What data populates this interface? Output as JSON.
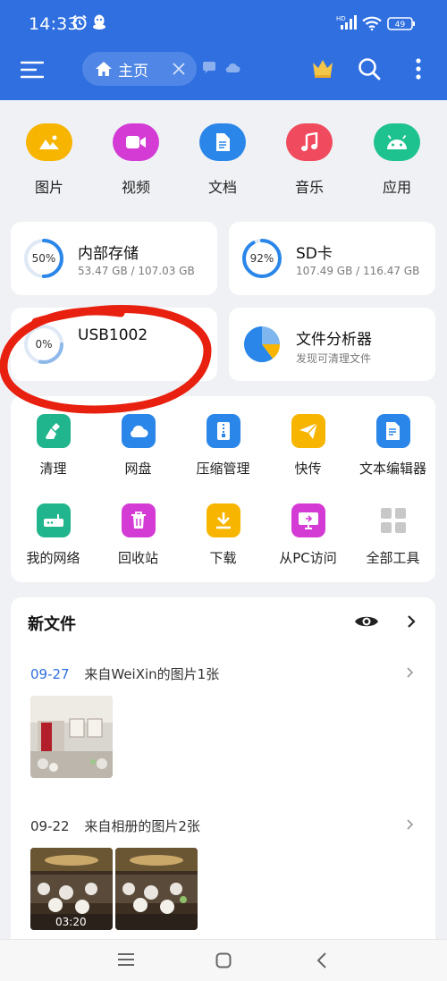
{
  "status": {
    "time": "14:33",
    "battery": "49",
    "network_badge": "HD"
  },
  "appbar": {
    "menu_icon": "menu-icon",
    "home_tab_label": "主页",
    "home_icon": "home-icon",
    "close_icon": "close-icon",
    "vip_icon": "crown-icon",
    "search_icon": "search-icon",
    "more_icon": "more-vert-icon"
  },
  "categories": [
    {
      "label": "图片",
      "icon": "image-icon",
      "color": "#f7b500"
    },
    {
      "label": "视频",
      "icon": "video-icon",
      "color": "#d33bd4"
    },
    {
      "label": "文档",
      "icon": "document-icon",
      "color": "#2a86e8"
    },
    {
      "label": "音乐",
      "icon": "music-icon",
      "color": "#f04a5e"
    },
    {
      "label": "应用",
      "icon": "android-icon",
      "color": "#1ec28e"
    }
  ],
  "storage": {
    "internal": {
      "title": "内部存储",
      "percent_label": "50%",
      "percent": 50,
      "detail": "53.47 GB / 107.03 GB"
    },
    "sd": {
      "title": "SD卡",
      "percent_label": "92%",
      "percent": 92,
      "detail": "107.49 GB / 116.47 GB"
    },
    "usb": {
      "title": "USB1002",
      "percent_label": "0%",
      "percent": 0
    },
    "analyzer": {
      "title": "文件分析器",
      "detail": "发现可清理文件"
    }
  },
  "tools": [
    {
      "label": "清理",
      "icon": "broom-icon",
      "color": "#20b58c"
    },
    {
      "label": "网盘",
      "icon": "cloud-drive-icon",
      "color": "#2a86e8"
    },
    {
      "label": "压缩管理",
      "icon": "zip-icon",
      "color": "#2a86e8"
    },
    {
      "label": "快传",
      "icon": "send-icon",
      "color": "#f7b500"
    },
    {
      "label": "文本编辑器",
      "icon": "text-edit-icon",
      "color": "#2a86e8"
    },
    {
      "label": "我的网络",
      "icon": "network-icon",
      "color": "#20b58c"
    },
    {
      "label": "回收站",
      "icon": "trash-icon",
      "color": "#d33bd4"
    },
    {
      "label": "下载",
      "icon": "download-icon",
      "color": "#f7b500"
    },
    {
      "label": "从PC访问",
      "icon": "pc-access-icon",
      "color": "#d33bd4"
    },
    {
      "label": "全部工具",
      "icon": "grid-icon",
      "color": "#c8c8c8"
    }
  ],
  "newfiles": {
    "title": "新文件",
    "groups": [
      {
        "date": "09-27",
        "source": "来自WeiXin的图片1张"
      },
      {
        "date": "09-22",
        "source": "来自相册的图片2张",
        "duration": "03:20"
      }
    ]
  },
  "colors": {
    "primary": "#2f6fe0",
    "ring": "#2a86e8",
    "annotation": "#e8200f"
  }
}
